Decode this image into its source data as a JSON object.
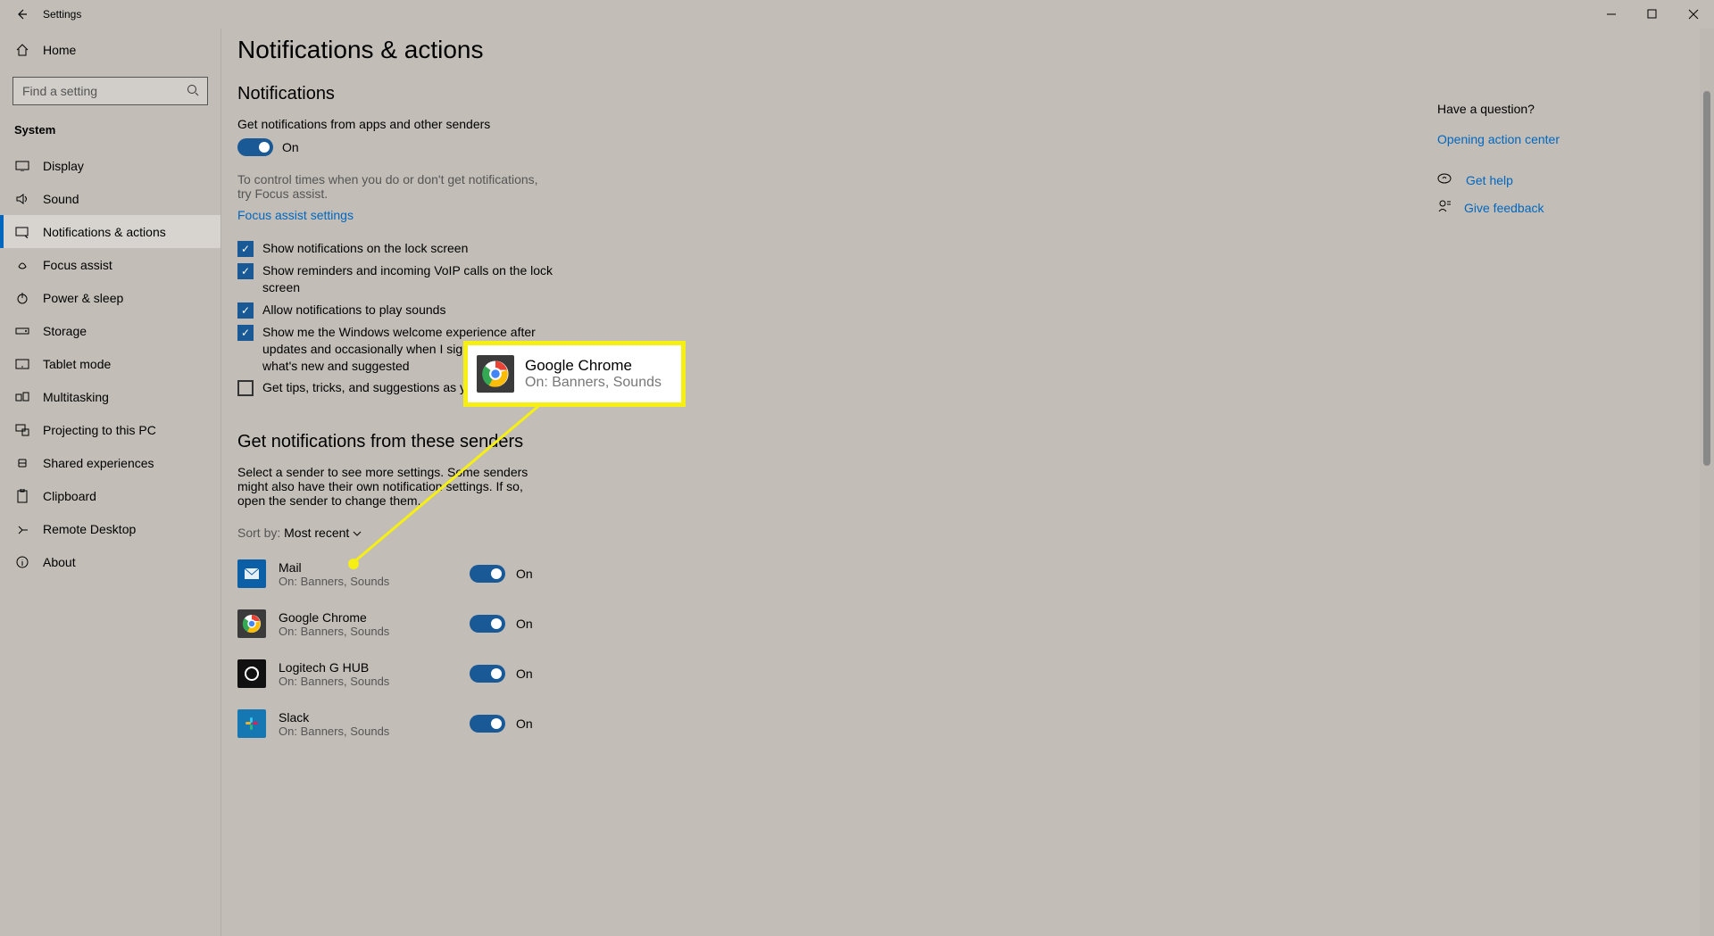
{
  "titlebar": {
    "title": "Settings"
  },
  "sidebar": {
    "home": "Home",
    "search_placeholder": "Find a setting",
    "group": "System",
    "items": [
      {
        "label": "Display"
      },
      {
        "label": "Sound"
      },
      {
        "label": "Notifications & actions"
      },
      {
        "label": "Focus assist"
      },
      {
        "label": "Power & sleep"
      },
      {
        "label": "Storage"
      },
      {
        "label": "Tablet mode"
      },
      {
        "label": "Multitasking"
      },
      {
        "label": "Projecting to this PC"
      },
      {
        "label": "Shared experiences"
      },
      {
        "label": "Clipboard"
      },
      {
        "label": "Remote Desktop"
      },
      {
        "label": "About"
      }
    ]
  },
  "page": {
    "title": "Notifications & actions",
    "notifications_header": "Notifications",
    "get_notifs_label": "Get notifications from apps and other senders",
    "toggle_on": "On",
    "focus_hint": "To control times when you do or don't get notifications, try Focus assist.",
    "focus_link": "Focus assist settings",
    "checks": [
      "Show notifications on the lock screen",
      "Show reminders and incoming VoIP calls on the lock screen",
      "Allow notifications to play sounds",
      "Show me the Windows welcome experience after updates and occasionally when I sign in to highlight what's new and suggested",
      "Get tips, tricks, and suggestions as you use Windows"
    ],
    "senders_header": "Get notifications from these senders",
    "senders_hint": "Select a sender to see more settings. Some senders might also have their own notification settings. If so, open the sender to change them.",
    "sort_label": "Sort by:",
    "sort_value": "Most recent",
    "senders": [
      {
        "name": "Mail",
        "sub": "On: Banners, Sounds"
      },
      {
        "name": "Google Chrome",
        "sub": "On: Banners, Sounds"
      },
      {
        "name": "Logitech G HUB",
        "sub": "On: Banners, Sounds"
      },
      {
        "name": "Slack",
        "sub": "On: Banners, Sounds"
      }
    ]
  },
  "right": {
    "question": "Have a question?",
    "opening": "Opening action center",
    "get_help": "Get help",
    "give_feedback": "Give feedback"
  },
  "callout": {
    "name": "Google Chrome",
    "sub": "On: Banners, Sounds"
  }
}
